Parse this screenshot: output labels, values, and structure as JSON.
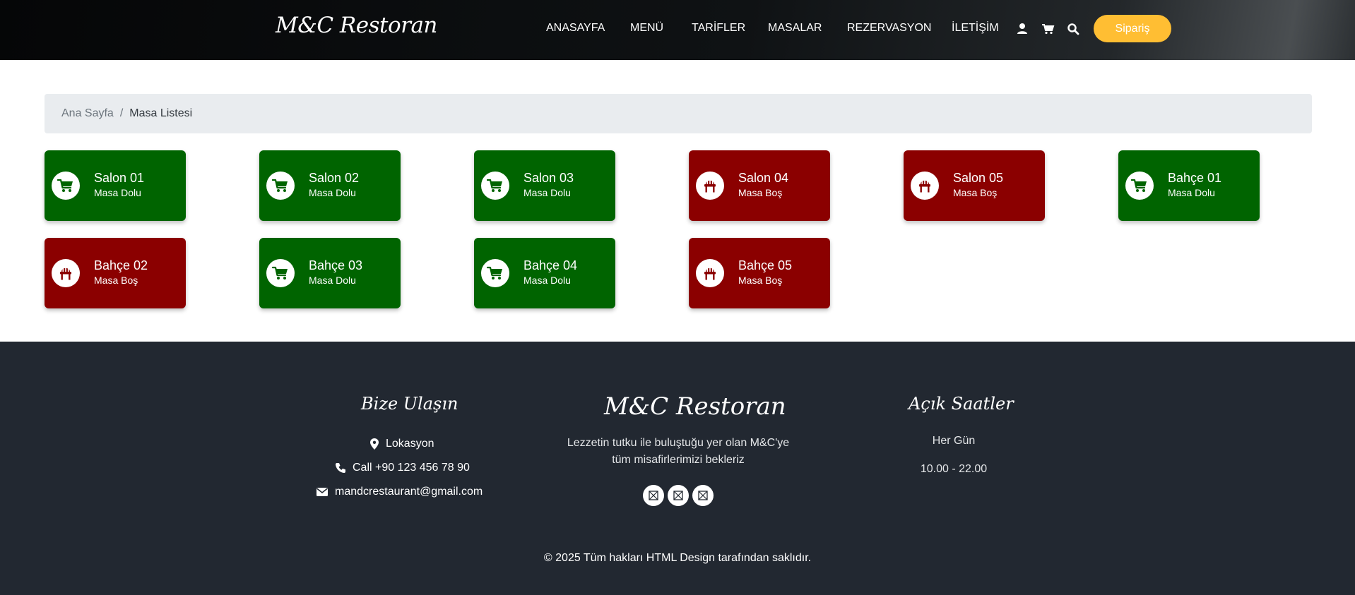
{
  "header": {
    "brand": "M&C Restoran",
    "nav": [
      "ANASAYFA",
      "MENÜ",
      "TARİFLER",
      "MASALAR",
      "REZERVASYON",
      "İLETİŞİM"
    ],
    "icons": [
      "user-icon",
      "cart-icon",
      "search-icon"
    ],
    "order_button": "Sipariş"
  },
  "breadcrumb": {
    "home": "Ana Sayfa",
    "separator": "/",
    "current": "Masa Listesi"
  },
  "tables": [
    {
      "name": "Salon 01",
      "status": "Masa Dolu",
      "state": "full"
    },
    {
      "name": "Salon 02",
      "status": "Masa Dolu",
      "state": "full"
    },
    {
      "name": "Salon 03",
      "status": "Masa Dolu",
      "state": "full"
    },
    {
      "name": "Salon 04",
      "status": "Masa Boş",
      "state": "empty"
    },
    {
      "name": "Salon 05",
      "status": "Masa Boş",
      "state": "empty"
    },
    {
      "name": "Bahçe 01",
      "status": "Masa Dolu",
      "state": "full"
    },
    {
      "name": "Bahçe 02",
      "status": "Masa Boş",
      "state": "empty"
    },
    {
      "name": "Bahçe 03",
      "status": "Masa Dolu",
      "state": "full"
    },
    {
      "name": "Bahçe 04",
      "status": "Masa Dolu",
      "state": "full"
    },
    {
      "name": "Bahçe 05",
      "status": "Masa Boş",
      "state": "empty"
    }
  ],
  "colors": {
    "full": "#006400",
    "empty": "#8b0000",
    "accent": "#ffbe33",
    "footer_bg": "#222831"
  },
  "footer": {
    "contact_title": "Bize Ulaşın",
    "location": "Lokasyon",
    "phone": "Call +90 123 456 78 90",
    "email": "mandcrestaurant@gmail.com",
    "brand": "M&C Restoran",
    "tagline_1": "Lezzetin tutku ile buluştuğu yer olan M&C'ye",
    "tagline_2": "tüm misafirlerimizi bekleriz",
    "social": [
      "facebook-icon",
      "twitter-icon",
      "instagram-icon"
    ],
    "hours_title": "Açık Saatler",
    "hours_days": "Her Gün",
    "hours_time": "10.00 - 22.00",
    "copyright": "© 2025 Tüm hakları HTML Design tarafından saklıdır."
  }
}
